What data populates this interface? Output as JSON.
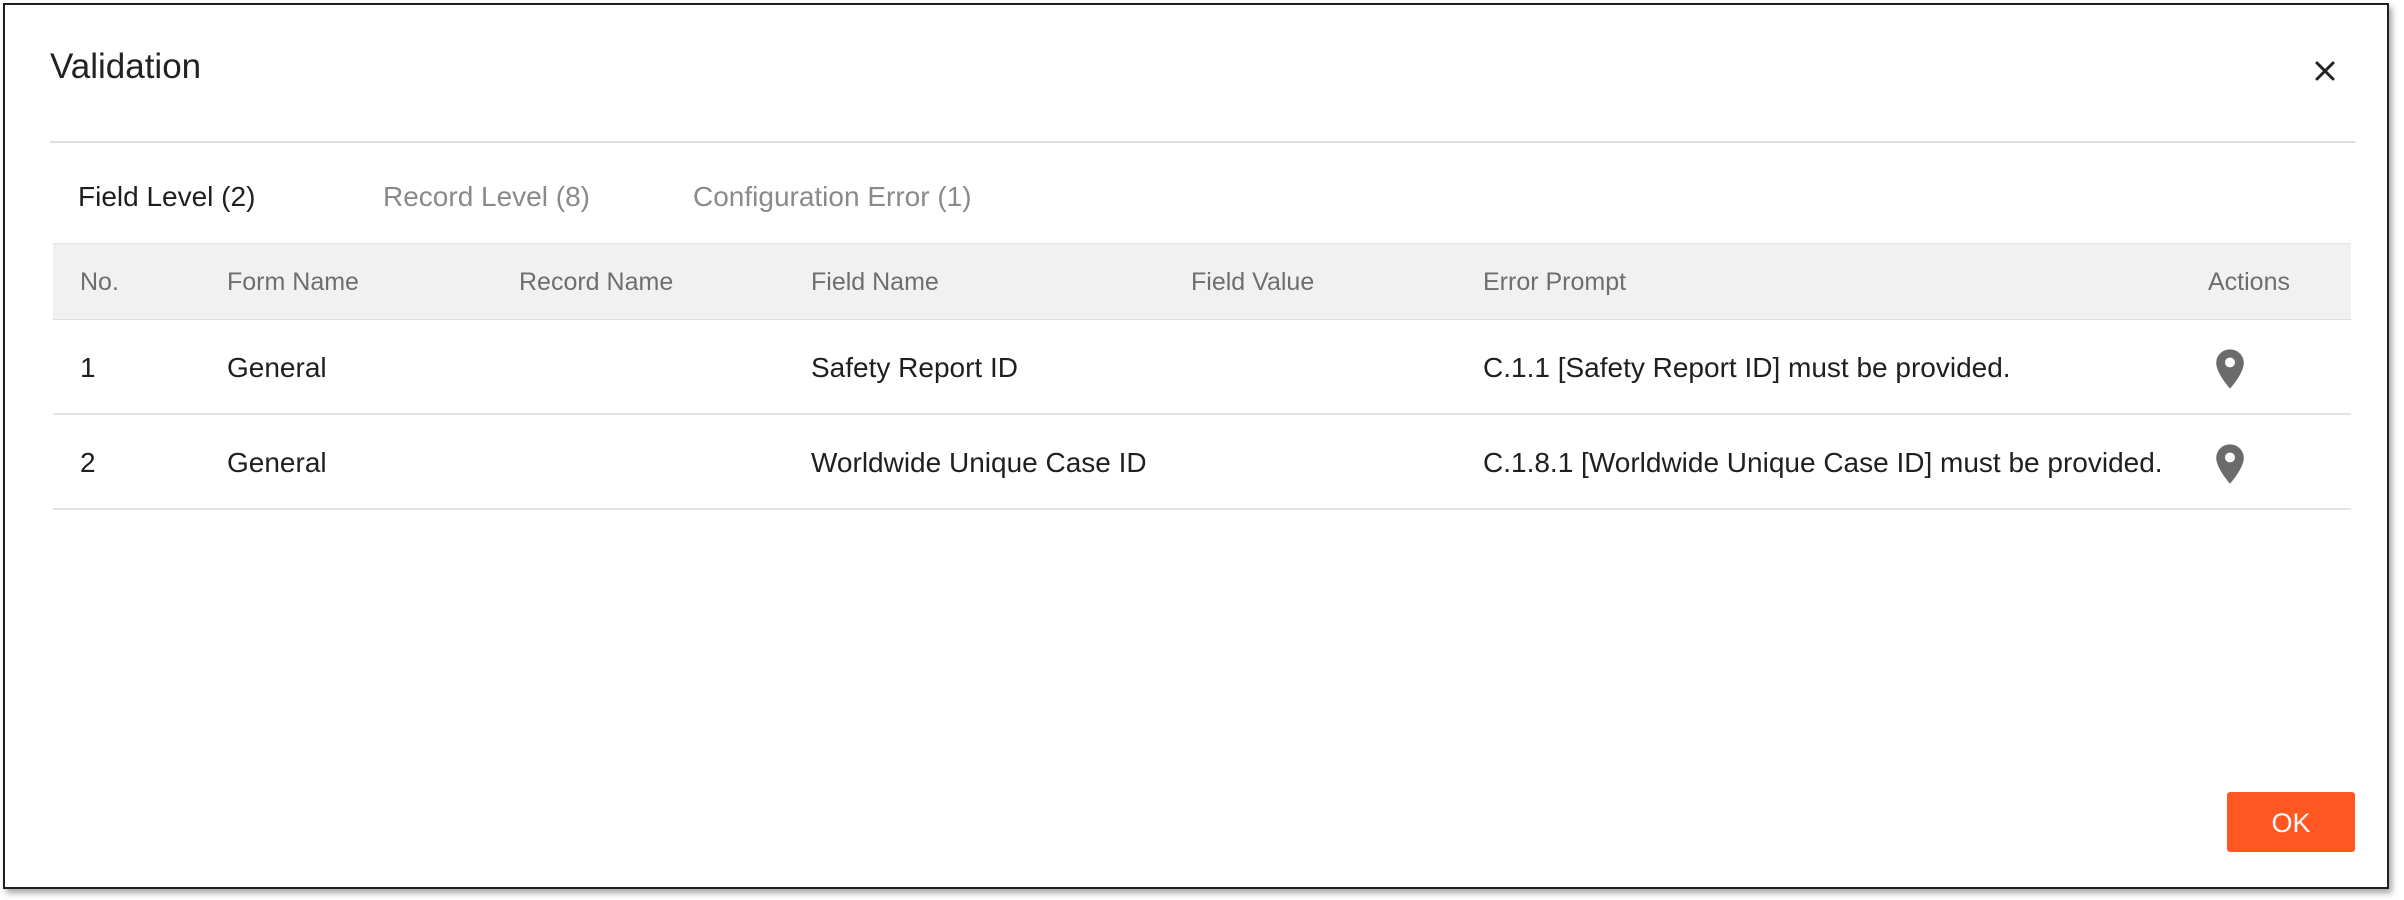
{
  "dialog": {
    "title": "Validation",
    "close_icon": "close-icon"
  },
  "tabs": [
    {
      "label": "Field Level (2)",
      "active": true
    },
    {
      "label": "Record Level (8)",
      "active": false
    },
    {
      "label": "Configuration Error (1)",
      "active": false
    }
  ],
  "table": {
    "columns": [
      "No.",
      "Form Name",
      "Record Name",
      "Field Name",
      "Field Value",
      "Error Prompt",
      "Actions"
    ],
    "rows": [
      {
        "no": "1",
        "form_name": "General",
        "record_name": "",
        "field_name": "Safety Report ID",
        "field_value": "",
        "error_prompt": "C.1.1 [Safety Report ID] must be provided.",
        "action_icon": "location-pin-icon"
      },
      {
        "no": "2",
        "form_name": "General",
        "record_name": "",
        "field_name": "Worldwide Unique Case ID",
        "field_value": "",
        "error_prompt": "C.1.8.1 [Worldwide Unique Case ID] must be provided.",
        "action_icon": "location-pin-icon"
      }
    ]
  },
  "footer": {
    "ok_label": "OK"
  },
  "colors": {
    "accent": "#ff5722",
    "header_bg": "#f1f1f1",
    "icon": "#6b6b6b"
  }
}
